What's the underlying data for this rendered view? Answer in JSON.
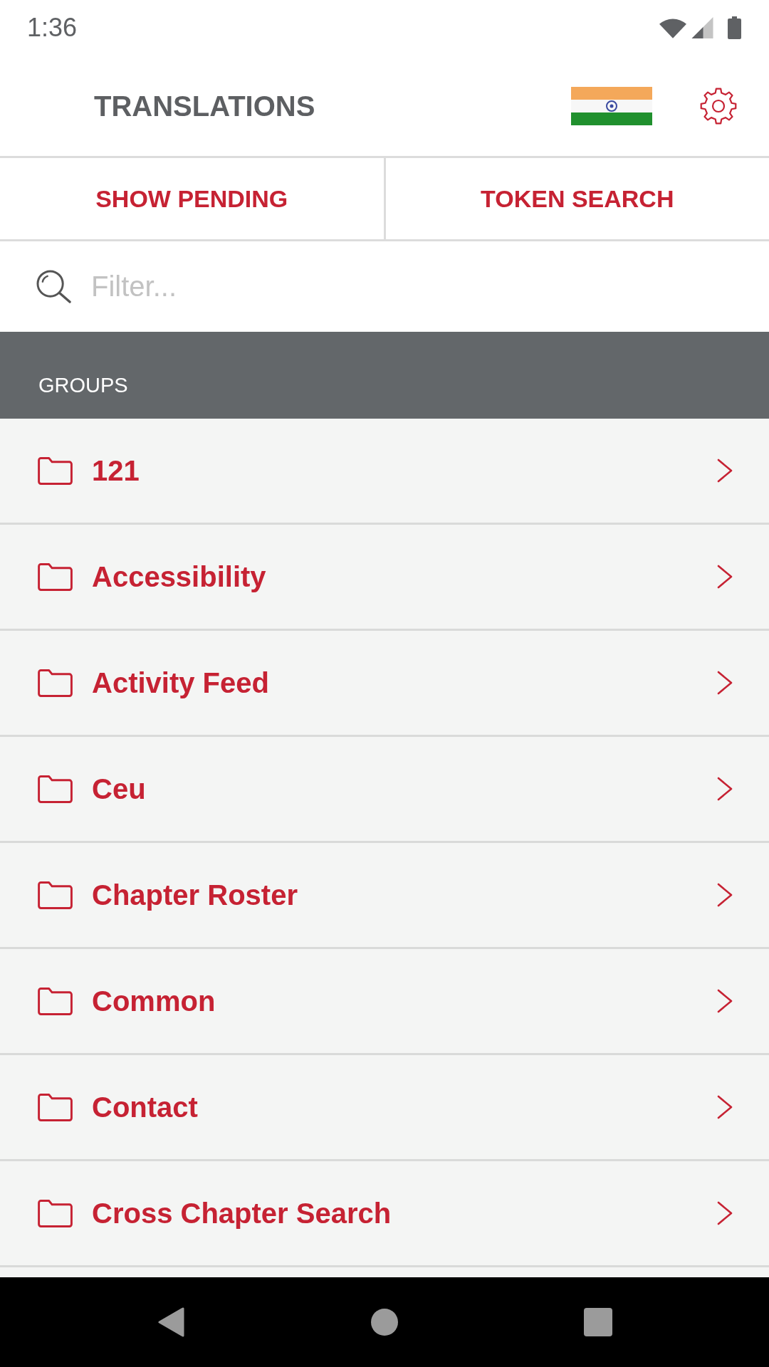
{
  "status_bar": {
    "time": "1:36"
  },
  "header": {
    "title": "TRANSLATIONS"
  },
  "actions": [
    {
      "label": "SHOW PENDING"
    },
    {
      "label": "TOKEN SEARCH"
    }
  ],
  "filter": {
    "placeholder": "Filter..."
  },
  "groups": {
    "heading": "GROUPS",
    "items": [
      {
        "label": "121"
      },
      {
        "label": "Accessibility"
      },
      {
        "label": "Activity Feed"
      },
      {
        "label": "Ceu"
      },
      {
        "label": "Chapter Roster"
      },
      {
        "label": "Common"
      },
      {
        "label": "Contact"
      },
      {
        "label": "Cross Chapter Search"
      }
    ]
  }
}
